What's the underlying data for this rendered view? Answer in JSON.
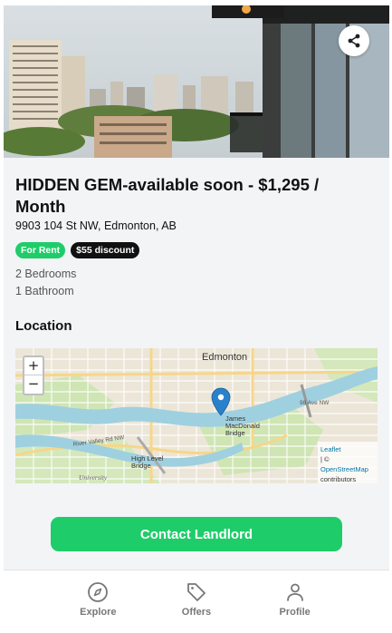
{
  "listing": {
    "title": "HIDDEN GEM-available soon - $1,295 / Month",
    "address": "9903 104 St NW, Edmonton, AB",
    "badges": [
      "For Rent",
      "$55 discount"
    ],
    "bedrooms": "2 Bedrooms",
    "bathrooms": "1 Bathroom"
  },
  "location": {
    "heading": "Location",
    "map_labels": {
      "city": "Edmonton",
      "bridge_1": "James\nMacDonald\nBridge",
      "bridge_2": "High Level\nBridge",
      "road_1": "River Valley Rd NW",
      "road_2": "98 Ave NW",
      "road_3": "University"
    },
    "zoom_in": "+",
    "zoom_out": "−",
    "attribution": {
      "leaflet": "Leaflet",
      "sep": "| ©",
      "osm": "OpenStreetMap",
      "contributors": "contributors"
    }
  },
  "cta": {
    "label": "Contact Landlord"
  },
  "nav": {
    "items": [
      {
        "label": "Explore",
        "icon": "compass-icon"
      },
      {
        "label": "Offers",
        "icon": "tag-icon"
      },
      {
        "label": "Profile",
        "icon": "person-icon"
      }
    ]
  },
  "colors": {
    "accent": "#1fcc6a",
    "badge_dark": "#111111",
    "map_pin": "#2a81cb",
    "river": "#9fd0e0"
  }
}
